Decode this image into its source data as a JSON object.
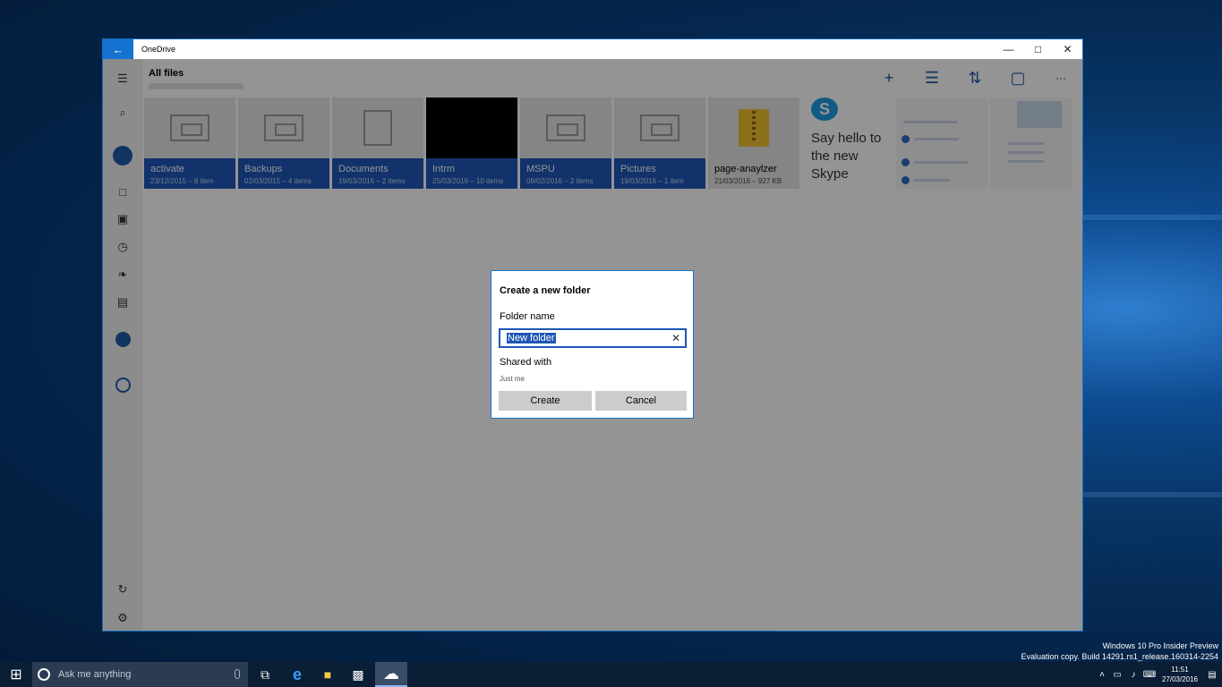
{
  "window": {
    "title": "OneDrive",
    "back_icon": "←",
    "minimize_icon": "—",
    "maximize_icon": "□",
    "close_icon": "✕"
  },
  "sidebar": {
    "menu_icon": "☰",
    "search_icon": "⌕",
    "files_icon": "□",
    "photos_icon": "▣",
    "recent_icon": "◷",
    "shared_icon": "❧",
    "recycle_icon": "▤",
    "sync_icon": "↻",
    "settings_icon": "⚙"
  },
  "header": {
    "title": "All files",
    "add_icon": "+",
    "select_icon": "☰",
    "sort_icon": "⇅",
    "view_icon": "▢",
    "more_icon": "···"
  },
  "tiles": [
    {
      "name": "activate",
      "meta": "23/12/2015 – 8 item",
      "kind": "folder"
    },
    {
      "name": "Backups",
      "meta": "02/03/2015 – 4 items",
      "kind": "folder"
    },
    {
      "name": "Documents",
      "meta": "19/03/2016 – 2 items",
      "kind": "doc"
    },
    {
      "name": "Intrm",
      "meta": "25/03/2016 – 10 items",
      "kind": "dark"
    },
    {
      "name": "MSPU",
      "meta": "08/02/2016 – 2 items",
      "kind": "folder"
    },
    {
      "name": "Pictures",
      "meta": "19/03/2016 – 1 item",
      "kind": "folder"
    },
    {
      "name": "page-anaylzer",
      "meta": "21/03/2016 – 927 KB",
      "kind": "zip"
    }
  ],
  "skype_tile": {
    "logo": "S",
    "line1": "Say hello to",
    "line2": "the new",
    "line3": "Skype"
  },
  "dialog": {
    "title": "Create a new folder",
    "folder_label": "Folder name",
    "folder_value": "New folder",
    "clear_icon": "✕",
    "shared_label": "Shared with",
    "shared_value": "Just me",
    "create_label": "Create",
    "cancel_label": "Cancel"
  },
  "watermark": {
    "line1": "Windows 10 Pro Insider Preview",
    "line2": "Evaluation copy. Build 14291.rs1_release.160314-2254"
  },
  "taskbar": {
    "start_icon": "⊞",
    "search_placeholder": "Ask me anything",
    "task_view_icon": "⧉",
    "edge_icon": "e",
    "explorer_icon": "■",
    "store_icon": "▩",
    "onedrive_icon": "☁",
    "tray_up_icon": "˄",
    "network_icon": "▭",
    "volume_icon": "♪",
    "notifications_icon": "▤",
    "time": "11:51",
    "date": "27/03/2016"
  }
}
